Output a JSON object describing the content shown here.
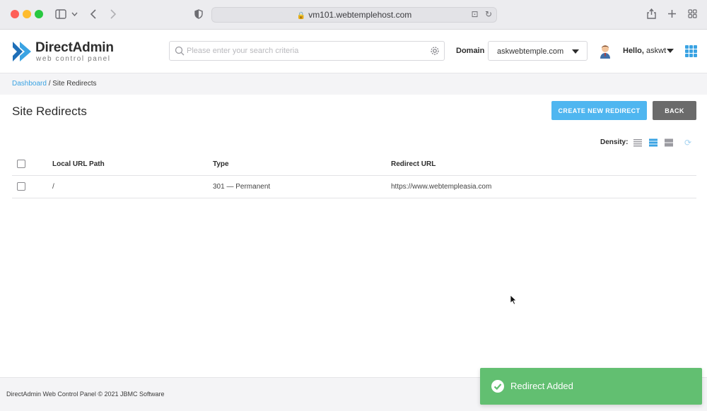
{
  "browser": {
    "url": "vm101.webtemplehost.com"
  },
  "header": {
    "logo_title": "DirectAdmin",
    "logo_subtitle": "web control panel",
    "search_placeholder": "Please enter your search criteria",
    "domain_label": "Domain",
    "domain_value": "askwebtemple.com",
    "hello_label": "Hello,",
    "username": "askwt",
    "accent_color": "#3aa3e3"
  },
  "breadcrumb": {
    "home": "Dashboard",
    "separator": " / ",
    "current": "Site Redirects"
  },
  "page": {
    "title": "Site Redirects",
    "create_button": "CREATE NEW REDIRECT",
    "back_button": "BACK",
    "density_label": "Density:"
  },
  "table": {
    "columns": [
      "Local URL Path",
      "Type",
      "Redirect URL"
    ],
    "rows": [
      {
        "path": "/",
        "type": "301 — Permanent",
        "url": "https://www.webtempleasia.com"
      }
    ]
  },
  "footer": {
    "text": "DirectAdmin Web Control Panel © 2021 JBMC Software"
  },
  "toast": {
    "message": "Redirect Added",
    "color": "#62bf71"
  }
}
